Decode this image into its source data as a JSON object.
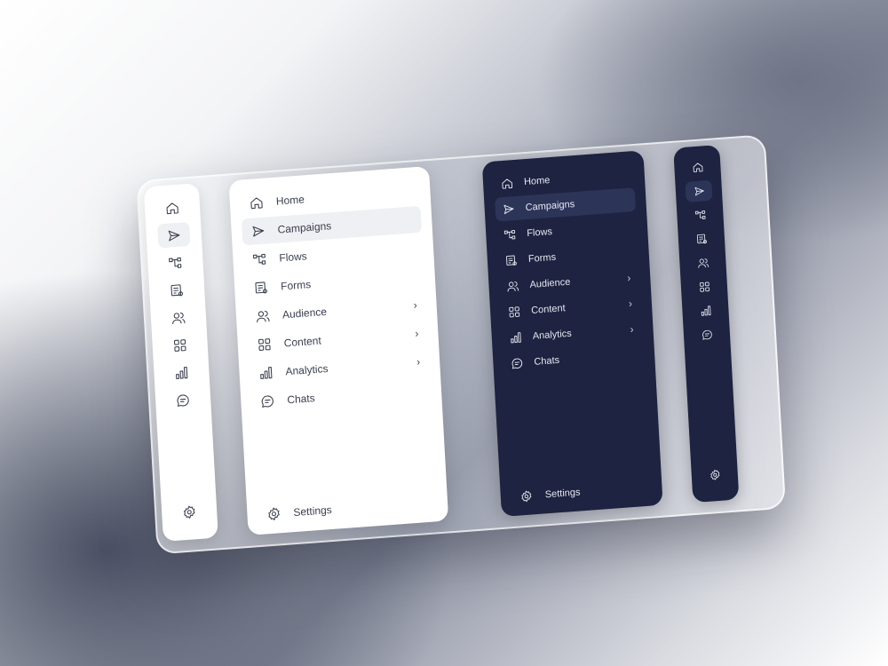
{
  "nav": {
    "items": [
      {
        "label": "Home",
        "icon": "home-icon"
      },
      {
        "label": "Campaigns",
        "icon": "send-icon",
        "active": true
      },
      {
        "label": "Flows",
        "icon": "flows-icon"
      },
      {
        "label": "Forms",
        "icon": "forms-icon"
      },
      {
        "label": "Audience",
        "icon": "users-icon",
        "has_submenu": true
      },
      {
        "label": "Content",
        "icon": "grid-icon",
        "has_submenu": true
      },
      {
        "label": "Analytics",
        "icon": "chart-icon",
        "has_submenu": true
      },
      {
        "label": "Chats",
        "icon": "chat-icon"
      }
    ],
    "settings_label": "Settings",
    "chevron": "›"
  },
  "theme": {
    "light_bg": "#ffffff",
    "light_active": "#eef0f3",
    "dark_bg": "#1d2340",
    "dark_active": "#2c3458"
  }
}
